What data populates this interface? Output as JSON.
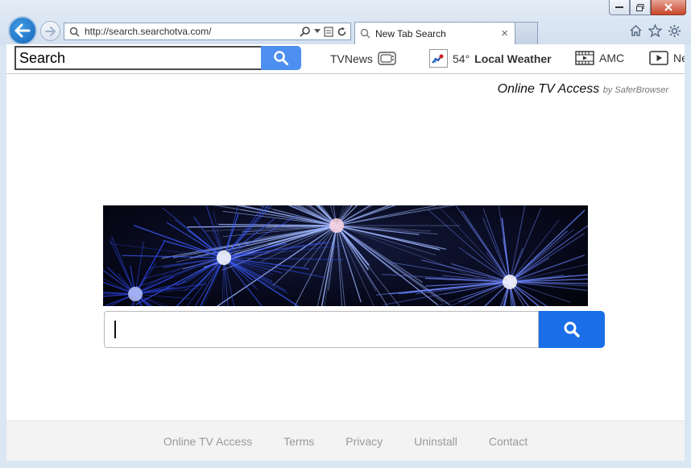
{
  "browser": {
    "url": "http://search.searchotva.com/",
    "tab_title": "New Tab Search",
    "tab_close": "×"
  },
  "toolbar": {
    "search_placeholder": "Search",
    "tvnews_label": "TVNews",
    "weather_temp": "54°",
    "weather_label": "Local Weather",
    "amc_label": "AMC",
    "next_label": "Ne"
  },
  "page": {
    "brand_title": "Online TV Access",
    "brand_by": "by SaferBrowser"
  },
  "footer": {
    "links": [
      "Online TV Access",
      "Terms",
      "Privacy",
      "Uninstall",
      "Contact"
    ]
  },
  "colors": {
    "toolbar_search_button": "#4d8ff0",
    "main_search_button": "#1a6fe8"
  }
}
